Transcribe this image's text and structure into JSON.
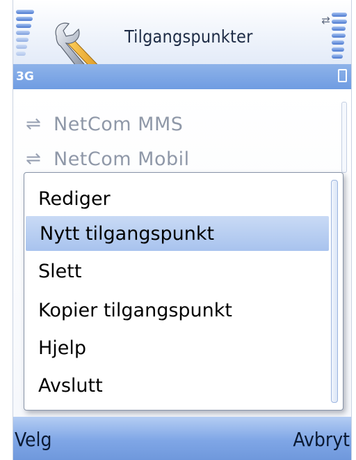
{
  "title": "Tilgangspunkter",
  "status": {
    "network": "3G"
  },
  "icons": {
    "title": "wrench-settings-icon",
    "signal": "signal-strength-icon",
    "battery": "battery-level-icon",
    "data_connection": "packet-data-icon",
    "list_item": "access-point-icon"
  },
  "list": {
    "items": [
      {
        "label": "NetCom MMS"
      },
      {
        "label": "NetCom Mobil"
      }
    ]
  },
  "menu": {
    "items": [
      {
        "label": "Rediger",
        "selected": false
      },
      {
        "label": "Nytt tilgangspunkt",
        "selected": true
      },
      {
        "label": "Slett",
        "selected": false
      },
      {
        "label": "Kopier tilgangspunkt",
        "selected": false
      },
      {
        "label": "Hjelp",
        "selected": false
      },
      {
        "label": "Avslutt",
        "selected": false
      }
    ]
  },
  "softkeys": {
    "left": "Velg",
    "right": "Avbryt"
  },
  "colors": {
    "accent": "#7fa6e6",
    "selection": "#a8c3ee",
    "text": "#000000",
    "dimmed_text": "#8f98a8"
  }
}
